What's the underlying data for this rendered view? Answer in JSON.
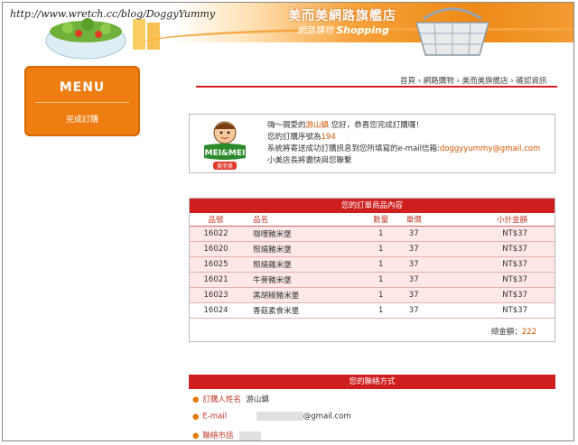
{
  "watermark": "http://www.wretch.cc/blog/DoggyYummy",
  "store": {
    "title": "美而美網路旗艦店",
    "subtitle_cn": "網路購物",
    "subtitle_en": "Shopping"
  },
  "menu": {
    "title": "MENU",
    "items": [
      {
        "label": "完成訂購"
      }
    ]
  },
  "breadcrumb": {
    "text": "首頁 › 網路購物 › 美而美旗艦店 › 確認資訊"
  },
  "confirm": {
    "logo_text": "MEI&MEI",
    "logo_sub": "美而美",
    "line1_pre": "嗨～親愛的",
    "customer_name": "游山鎮",
    "line1_post": "您好，恭喜您完成訂購囉！",
    "line2_pre": "您的訂購序號為",
    "order_no": "194",
    "line3_pre": "系統將寄送成功訂購訊息到您所填寫的e-mail信箱:",
    "email": "doggyyummy@gmail.com",
    "line4": "小美店長將盡快與您聯繫"
  },
  "order": {
    "title": "您的訂單商品內容",
    "columns": [
      "品號",
      "品名",
      "數量",
      "單價",
      "小計金額"
    ],
    "rows": [
      {
        "id": "16022",
        "name": "咖哩豬米堡",
        "qty": "1",
        "price": "37",
        "subtotal": "NT$37"
      },
      {
        "id": "16020",
        "name": "照燒豬米堡",
        "qty": "1",
        "price": "37",
        "subtotal": "NT$37"
      },
      {
        "id": "16025",
        "name": "照燒雞米堡",
        "qty": "1",
        "price": "37",
        "subtotal": "NT$37"
      },
      {
        "id": "16021",
        "name": "牛蒡豬米堡",
        "qty": "1",
        "price": "37",
        "subtotal": "NT$37"
      },
      {
        "id": "16023",
        "name": "黑胡椒豬米堡",
        "qty": "1",
        "price": "37",
        "subtotal": "NT$37"
      },
      {
        "id": "16024",
        "name": "香菇素食米堡",
        "qty": "1",
        "price": "37",
        "subtotal": "NT$37"
      }
    ],
    "total_label": "總金額：",
    "total_value": "222"
  },
  "contact": {
    "title": "您的聯絡方式",
    "name_label": "訂購人姓名",
    "name_value": "游山鎮",
    "email_label": "E-mail",
    "email_suffix": "@gmail.com",
    "phone_label": "聯絡市話"
  },
  "colors": {
    "accent_red": "#cf1e1e",
    "accent_orange": "#ee7d12",
    "highlight": "#d35400"
  }
}
